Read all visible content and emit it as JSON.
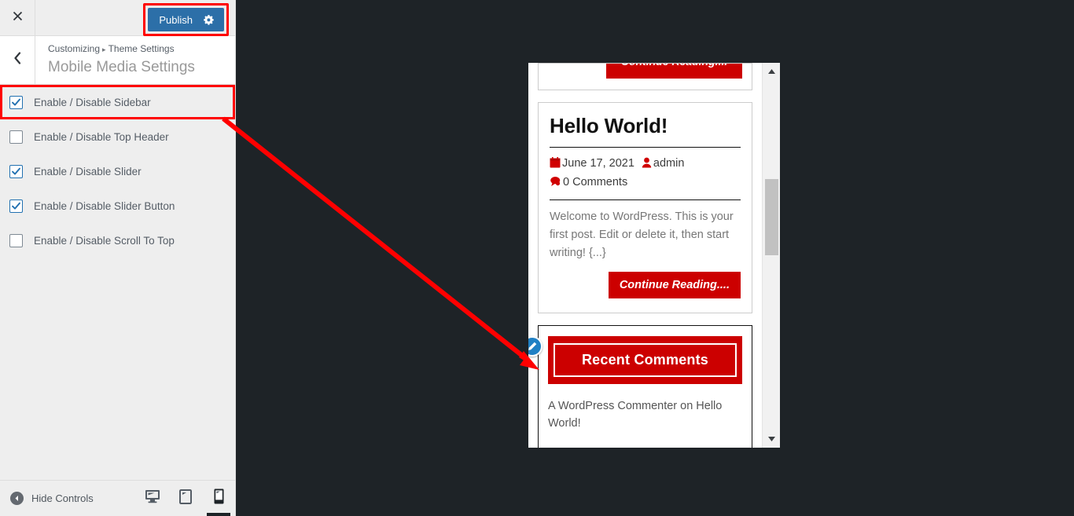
{
  "customizer": {
    "close_icon": "close-x-icon",
    "publish_label": "Publish",
    "publish_gear_icon": "gear-icon",
    "back_icon": "chevron-left-icon",
    "breadcrumb_root": "Customizing",
    "breadcrumb_sep": "▸",
    "breadcrumb_parent": "Theme Settings",
    "panel_title": "Mobile Media Settings",
    "accent_blue": "#2c6fa8",
    "annotation_red": "#ff0000"
  },
  "controls": [
    {
      "label": "Enable / Disable Sidebar",
      "checked": true,
      "highlighted": true
    },
    {
      "label": "Enable / Disable Top Header",
      "checked": false,
      "highlighted": false
    },
    {
      "label": "Enable / Disable Slider",
      "checked": true,
      "highlighted": false
    },
    {
      "label": "Enable / Disable Slider Button",
      "checked": true,
      "highlighted": false
    },
    {
      "label": "Enable / Disable Scroll To Top",
      "checked": false,
      "highlighted": false
    }
  ],
  "footer": {
    "hide_controls_label": "Hide Controls",
    "collapse_icon": "collapse-left-icon",
    "devices": [
      {
        "name": "desktop",
        "icon": "desktop-icon",
        "active": false
      },
      {
        "name": "tablet",
        "icon": "tablet-icon",
        "active": false
      },
      {
        "name": "mobile",
        "icon": "mobile-icon",
        "active": true
      }
    ]
  },
  "preview": {
    "device": "mobile",
    "brand_red": "#cc0000",
    "top_partial_button": "Continue Reading....",
    "post": {
      "title": "Hello World!",
      "date": "June 17, 2021",
      "date_icon": "calendar-icon",
      "author": "admin",
      "author_icon": "user-icon",
      "comments": "0 Comments",
      "comments_icon": "comment-icon",
      "excerpt": "Welcome to WordPress. This is your first post. Edit or delete it, then start writing! {...}",
      "read_more": "Continue Reading...."
    },
    "widget": {
      "title": "Recent Comments",
      "edit_icon": "pencil-edit-icon",
      "items": [
        "A WordPress Commenter on Hello World!"
      ]
    },
    "scrollbar": {
      "up_icon": "scroll-up-arrow-icon",
      "down_icon": "scroll-down-arrow-icon"
    }
  }
}
